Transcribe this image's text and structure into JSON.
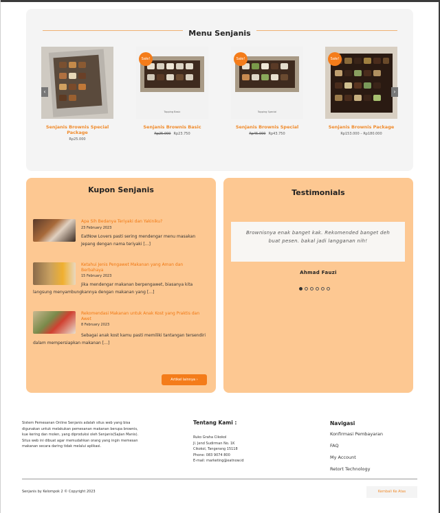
{
  "menu": {
    "title": "Menu Senjanis",
    "products": [
      {
        "name": "Senjanis Brownis Special Package",
        "prices": [
          "Rp25.000"
        ],
        "sale": false,
        "caption": ""
      },
      {
        "name": "Senjanis Brownis Basic",
        "prices": [
          "Rp25.000",
          "Rp23.750"
        ],
        "sale": true,
        "caption": "Topping Basic"
      },
      {
        "name": "Senjanis Brownis Special",
        "prices": [
          "Rp45.000",
          "Rp43.750"
        ],
        "sale": true,
        "caption": "Topping Special"
      },
      {
        "name": "Senjanis Brownis Package",
        "prices": [
          "Rp153.000 – Rp180.000"
        ],
        "sale": true,
        "caption": ""
      }
    ],
    "sale_label": "Sale!",
    "prev_icon": "chevron-left-icon",
    "next_icon": "chevron-right-icon"
  },
  "kupon": {
    "title": "Kupon Senjanis",
    "posts": [
      {
        "title": "Apa Sih Bedanya Teriyaki dan Yakiniku?",
        "date": "23 February 2023",
        "excerpt": "EatNow Lovers pasti sering mendengar menu masakan Jepang dengan nama teriyaki […]"
      },
      {
        "title": "Ketahui Jenis Pengawet Makanan yang Aman dan Berbahaya",
        "date": "15 February 2023",
        "excerpt": "Jika mendengar makanan berpengawet, biasanya kita langsung menyambungkannya dengan makanan yang […]"
      },
      {
        "title": "Rekomendasi Makanan untuk Anak Kost yang Praktis dan Awet",
        "date": "8 February 2023",
        "excerpt": "Sebagai anak kost kamu pasti memiliki tantangan tersendiri dalam mempersiapkan makanan […]"
      }
    ],
    "more_label": "Artikel lainnya"
  },
  "testimonials": {
    "title": "Testimonials",
    "quote": "Brownisnya enak banget kak. Rekomended banget deh buat pesen. bakal jadi langganan nih!",
    "author": "Ahmad Fauzi",
    "slides": 6,
    "active_slide": 1
  },
  "footer": {
    "about": "Sistem Pemesanan Online Senjanis adalah situs web yang bisa digunakan untuk melakukan pemesanan makanan berupa brownis, kue kering dan molen, yang diproduksi oleh Senjanis(Sajian Manis). Situs web ini dibuat agar memudahkan orang yang ingin memesan makanan secara daring tidak melalui aplikasi.",
    "contact_title": "Tentang Kami :",
    "contact_lines": [
      "Ruko Graha Cikokol",
      "Jl. Jend Sudirman No. 1K",
      "Cikokol, Tangerang 15118",
      "Phone: 083 9074 800",
      "E-mail: marketing@eatnow.id"
    ],
    "nav_title": "Navigasi",
    "nav_links": [
      "Konfirmasi Pembayaran",
      "FAQ",
      "My Account",
      "Retort Technology"
    ],
    "copyright": "Senjanis by Kelompok 2 © Copyright 2023",
    "back_to_top": "Kembali Ke Atas"
  },
  "colors": {
    "accent": "#f47c1a",
    "panel": "#fdc892",
    "card": "#f4f4f4"
  }
}
